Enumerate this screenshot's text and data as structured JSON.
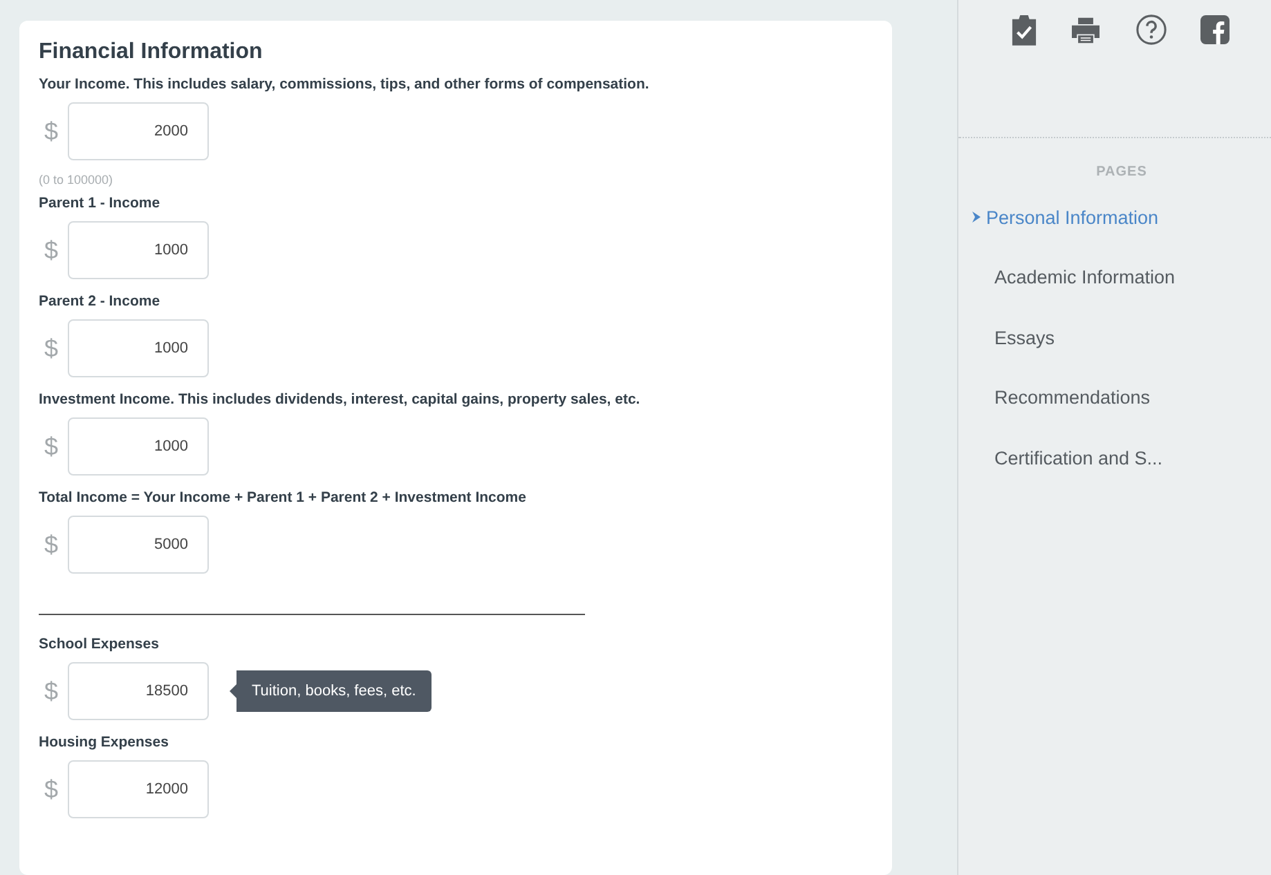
{
  "form": {
    "title": "Financial Information",
    "fields": [
      {
        "label": "Your Income. This includes salary, commissions, tips, and other forms of compensation.",
        "currency": "$",
        "value": "2000",
        "hint": "(0 to 100000)"
      },
      {
        "label": "Parent 1 - Income",
        "currency": "$",
        "value": "1000"
      },
      {
        "label": "Parent 2 - Income",
        "currency": "$",
        "value": "1000"
      },
      {
        "label": "Investment Income. This includes dividends, interest, capital gains, property sales, etc.",
        "currency": "$",
        "value": "1000"
      },
      {
        "label": "Total Income = Your Income + Parent 1 + Parent 2 + Investment Income",
        "currency": "$",
        "value": "5000",
        "divider_after": true
      },
      {
        "label": "School Expenses",
        "currency": "$",
        "value": "18500",
        "tooltip": "Tuition, books, fees, etc."
      },
      {
        "label": "Housing Expenses",
        "currency": "$",
        "value": "12000"
      }
    ]
  },
  "sidebar": {
    "toolbar": [
      {
        "kind": "clipboard"
      },
      {
        "kind": "print"
      },
      {
        "kind": "help"
      },
      {
        "kind": "facebook"
      }
    ],
    "heading": "PAGES",
    "pages": [
      {
        "label": "Personal Information",
        "selected": true
      },
      {
        "label": "Academic Information",
        "selected": false
      },
      {
        "label": "Essays",
        "selected": false
      },
      {
        "label": "Recommendations",
        "selected": false
      },
      {
        "label": "Certification and S...",
        "selected": false
      }
    ]
  }
}
